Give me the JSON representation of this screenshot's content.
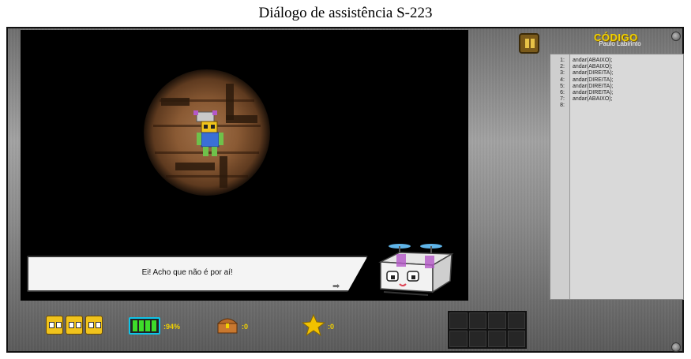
{
  "page": {
    "title": "Diálogo de assistência S-223"
  },
  "header": {
    "logo": "CÓDIGO",
    "subtitle": "Paulo Labirinto"
  },
  "dialog": {
    "message": "Ei! Acho que não é por aí!",
    "next_glyph": "➡"
  },
  "code_editor": {
    "lines": [
      {
        "num": "1:",
        "code": "andar(ABAIXO);"
      },
      {
        "num": "2:",
        "code": "andar(ABAIXO);"
      },
      {
        "num": "3:",
        "code": "andar(DIREITA);"
      },
      {
        "num": "4:",
        "code": "andar(DIREITA);"
      },
      {
        "num": "5:",
        "code": "andar(DIREITA);"
      },
      {
        "num": "6:",
        "code": "andar(DIREITA);"
      },
      {
        "num": "7:",
        "code": "andar(ABAIXO);"
      },
      {
        "num": "8:",
        "code": ""
      }
    ]
  },
  "hud": {
    "lives": 3,
    "battery_label": ":94%",
    "battery_level": 0.94,
    "chests_label": ":0",
    "stars_label": ":0"
  },
  "icons": {
    "pause": "pause-icon",
    "life": "robot-head-icon",
    "battery": "battery-icon",
    "chest": "treasure-chest-icon",
    "star": "star-icon"
  },
  "colors": {
    "accent_yellow": "#f2d200",
    "battery_green": "#3edc2a",
    "battery_border": "#0ec4e8"
  }
}
